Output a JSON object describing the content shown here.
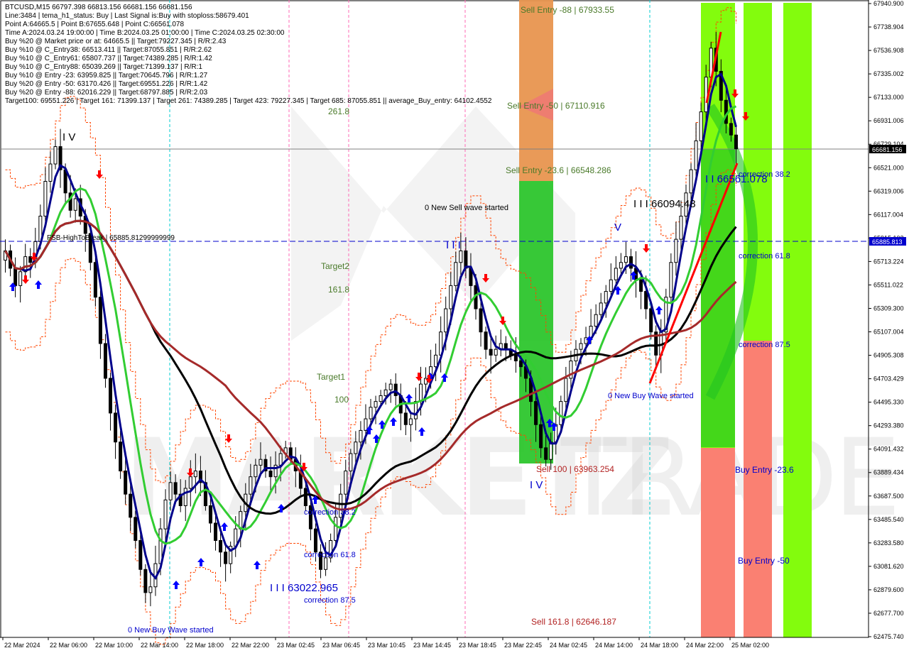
{
  "info": {
    "lines": [
      "BTCUSD,M15  66797.398 66813.156 66681.156 66681.156",
      "Line:3484  | tema_h1_status: Buy | Last Signal is:Buy with stoploss:58679.401",
      "Point A:64665.5  | Point B:67655.648  | Point C:66561.078",
      "Time A:2024.03.24 19:00:00  | Time B:2024.03.25 01:00:00  | Time C:2024.03.25 02:30:00",
      "Buy %20 @ Market price or at: 64665.5  || Target:79227.345  | R/R:2.43",
      "Buy %10 @ C_Entry38: 66513.411  || Target:87055.851  | R/R:2.62",
      "Buy %10 @ C_Entry61: 65807.737  || Target:74389.285  | R/R:1.42",
      "Buy %10 @ C_Entry88: 65039.269  || Target:71399.137  | R/R:1",
      "Buy %10 @ Entry -23: 63959.825  || Target:70645.796  | R/R:1.27",
      "Buy %20 @ Entry -50: 63170.426  || Target:69551.226  | R/R:1.42",
      "Buy %20 @ Entry -88: 62016.229  || Target:68797.885  | R/R:2.03",
      "Target100: 69551.226  | Target 161: 71399.137  | Target 261: 74389.285  | Target 423: 79227.345  | Target 685: 87055.851  || average_Buy_entry: 64102.4552"
    ]
  },
  "price_axis": {
    "ticks": [
      "67940.900",
      "67738.904",
      "67536.908",
      "67335.002",
      "67133.000",
      "66931.006",
      "66729.104",
      "66521.000",
      "66319.006",
      "66117.004",
      "65915.102",
      "65713.224",
      "65511.022",
      "65309.300",
      "65107.004",
      "64905.308",
      "64703.429",
      "64495.330",
      "64293.380",
      "64091.432",
      "63889.434",
      "63687.500",
      "63485.540",
      "63283.580",
      "63081.620",
      "62879.600",
      "62677.700",
      "62475.740"
    ],
    "current_price": "66681.156",
    "level_price": "65885.813"
  },
  "time_axis": {
    "labels": [
      "22 Mar 2024",
      "22 Mar 06:00",
      "22 Mar 10:00",
      "22 Mar 14:00",
      "22 Mar 18:00",
      "22 Mar 22:00",
      "23 Mar 02:45",
      "23 Mar 06:45",
      "23 Mar 10:45",
      "23 Mar 14:45",
      "23 Mar 18:45",
      "23 Mar 22:45",
      "24 Mar 02:45",
      "24 Mar 14:00",
      "24 Mar 18:00",
      "24 Mar 22:00",
      "25 Mar 02:00"
    ]
  },
  "labels": {
    "sell_entry_88": "Sell Entry -88 | 67933.55",
    "sell_entry_50": "Sell Entry -50 | 67110.916",
    "sell_entry_23": "Sell Entry -23.6 | 66548.286",
    "sell_100": "Sell 100 | 63963.254",
    "sell_161": "Sell 161.8 | 62646.187",
    "new_sell_wave": "0 New Sell wave started",
    "new_buy_wave_1": "0 New Buy Wave started",
    "new_buy_wave_2": "0 New Buy Wave started",
    "level_66094": "I I I 66094.48",
    "level_66561": "I I 66561.078",
    "level_63022": "I I I 63022.965",
    "correction_38_right": "correction 38.2",
    "correction_61_right": "correction 61.8",
    "correction_87_right": "correction 87.5",
    "correction_38_left": "correction 38.2",
    "correction_61_left": "correction 61.8",
    "correction_87_left": "correction 87.5",
    "buy_entry_23": "Buy Entry -23.6",
    "buy_entry_50": "Buy Entry -50",
    "target2": "Target2",
    "target1": "Target1",
    "fib_261": "261.8",
    "fib_161": "161.8",
    "fib_100": "100",
    "fsb": "FSB-HighToBreak | 65885.81299999999",
    "wave_iv_top": "I V",
    "wave_iii_mid": "I I I",
    "wave_v": "V",
    "wave_iv_bottom": "I V"
  },
  "watermark": {
    "left": "MARKETZ",
    "right": "TRADE"
  },
  "colors": {
    "background": "#ffffff",
    "bull_candle": "#000000",
    "bear_candle": "#000000",
    "ma_blue": "#00008b",
    "ma_green": "#32cd32",
    "ma_black": "#000000",
    "ma_brown": "#a52a2a",
    "envelope": "#ff4500",
    "buy_arrow": "#0000ff",
    "sell_arrow": "#ff0000",
    "zone_orange": "#e8954f",
    "zone_green": "#22c322",
    "zone_lime": "#7cfc00",
    "zone_salmon": "#fa8072"
  },
  "chart_data": {
    "type": "candlestick",
    "symbol": "BTCUSD",
    "timeframe": "M15",
    "ylim": [
      62475.74,
      67940.9
    ],
    "last": {
      "open": 66797.398,
      "high": 66813.156,
      "low": 66681.156,
      "close": 66681.156
    },
    "closes": [
      65800,
      65650,
      65500,
      65620,
      65750,
      65700,
      65880,
      66100,
      66400,
      66550,
      66700,
      66500,
      66300,
      66150,
      66250,
      66100,
      65950,
      65700,
      65400,
      65000,
      64700,
      64400,
      64150,
      63900,
      63700,
      63500,
      63300,
      63050,
      62850,
      62900,
      63100,
      63400,
      63650,
      63800,
      63700,
      63600,
      63750,
      63850,
      63900,
      63800,
      63600,
      63450,
      63300,
      63200,
      63100,
      63250,
      63400,
      63550,
      63700,
      63850,
      63950,
      64000,
      63900,
      63850,
      63950,
      64050,
      64100,
      64000,
      63900,
      63750,
      63600,
      63400,
      63200,
      63050,
      63150,
      63300,
      63500,
      63700,
      63900,
      64050,
      64150,
      64250,
      64350,
      64450,
      64500,
      64550,
      64600,
      64650,
      64550,
      64400,
      64300,
      64350,
      64500,
      64650,
      64700,
      64800,
      64900,
      65100,
      65300,
      65500,
      65700,
      65800,
      65650,
      65500,
      65300,
      65100,
      64950,
      64900,
      64950,
      65000,
      64950,
      64900,
      64850,
      64800,
      64700,
      64500,
      64300,
      64100,
      64000,
      64150,
      64300,
      64500,
      64700,
      64850,
      64950,
      65000,
      65050,
      65150,
      65250,
      65350,
      65450,
      65550,
      65650,
      65700,
      65750,
      65650,
      65550,
      65450,
      65300,
      65100,
      64900,
      65100,
      65400,
      65700,
      65900,
      66100,
      66300,
      66500,
      66750,
      67000,
      67300,
      67550,
      67350,
      67100,
      66900,
      66800,
      66681.156
    ]
  }
}
